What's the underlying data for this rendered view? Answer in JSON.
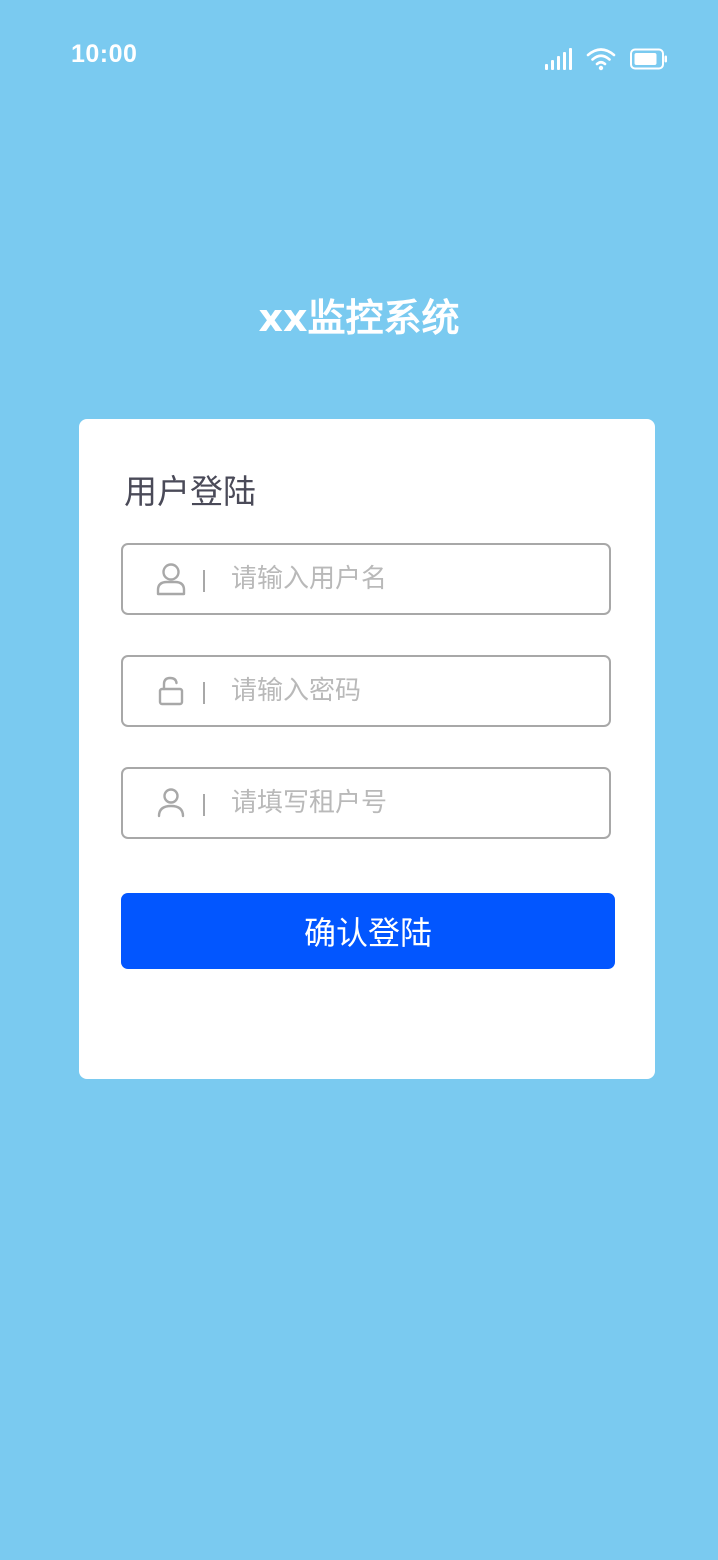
{
  "status_bar": {
    "time": "10:00",
    "icons": [
      "signal-icon",
      "wifi-icon",
      "battery-icon"
    ]
  },
  "app": {
    "title": "xx监控系统"
  },
  "login": {
    "title": "用户登陆",
    "fields": {
      "username": {
        "placeholder": "请输入用户名",
        "value": "",
        "icon": "user-icon"
      },
      "password": {
        "placeholder": "请输入密码",
        "value": "",
        "icon": "lock-icon"
      },
      "tenant": {
        "placeholder": "请填写租户号",
        "value": "",
        "icon": "user-icon"
      }
    },
    "submit_label": "确认登陆"
  },
  "colors": {
    "background": "#7ACAF0",
    "card": "#FFFFFF",
    "primary": "#0256FF",
    "border": "#A8A8A8",
    "placeholder": "#B9B9B9",
    "title_text": "#4A4A58"
  }
}
